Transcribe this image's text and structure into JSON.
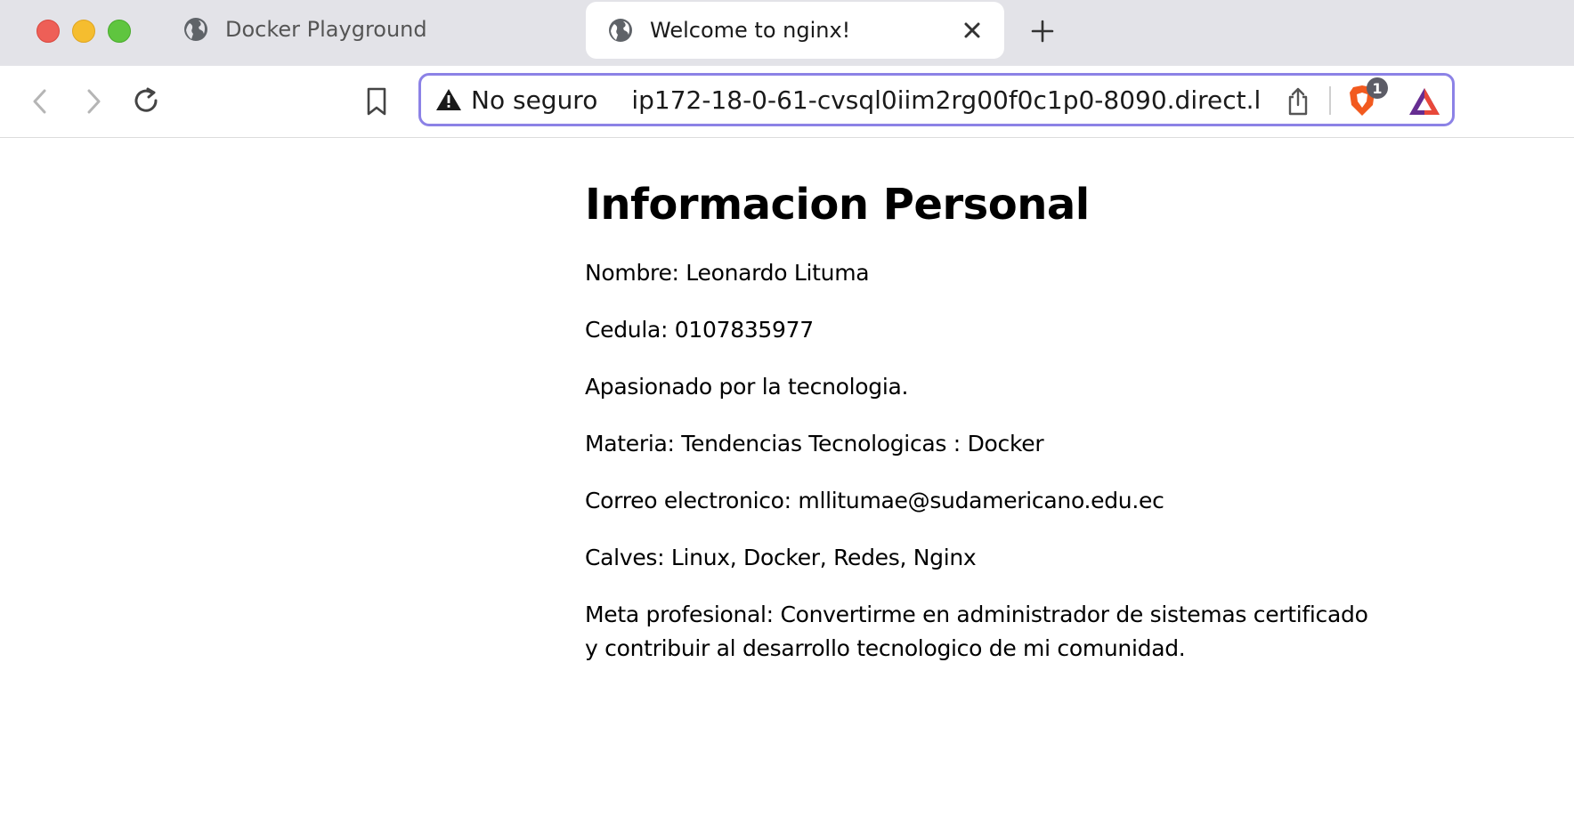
{
  "window": {
    "tabs": [
      {
        "title": "Docker Playground",
        "active": false
      },
      {
        "title": "Welcome to nginx!",
        "active": true
      }
    ]
  },
  "toolbar": {
    "security_label": "No seguro",
    "url": "ip172-18-0-61-cvsql0iim2rg00f0c1p0-8090.direct.l...",
    "shields_badge": "1"
  },
  "page": {
    "heading": "Informacion Personal",
    "lines": [
      "Nombre: Leonardo Lituma",
      "Cedula: 0107835977",
      "Apasionado por la tecnologia.",
      "Materia: Tendencias Tecnologicas : Docker",
      "Correo electronico: mllitumae@sudamericano.edu.ec",
      "Calves: Linux, Docker, Redes, Nginx",
      "Meta profesional: Convertirme en administrador de sistemas certificado y contribuir al desarrollo tecnologico de mi comunidad."
    ]
  },
  "colors": {
    "accent_urlbar_border": "#8c82e6",
    "tabstrip_bg": "#e3e3e8",
    "traffic_red": "#ee5f57",
    "traffic_yellow": "#f5bd2f",
    "traffic_green": "#5fc53f"
  },
  "icons": [
    "globe-icon",
    "close-icon",
    "plus-icon",
    "back-icon",
    "forward-icon",
    "reload-icon",
    "bookmark-icon",
    "warning-icon",
    "share-icon",
    "brave-shields-icon",
    "brave-rewards-icon"
  ]
}
